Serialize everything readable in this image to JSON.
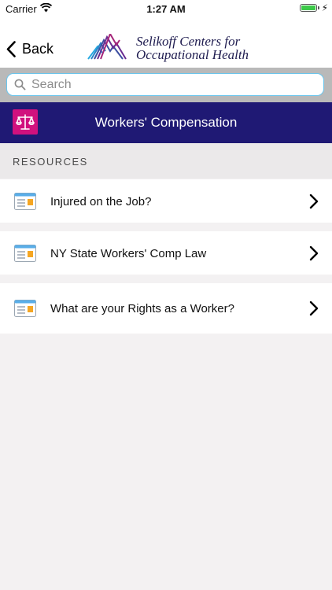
{
  "status": {
    "carrier": "Carrier",
    "time": "1:27 AM",
    "battery_level": 1.0
  },
  "nav": {
    "back_label": "Back",
    "logo_line1": "Selikoff Centers for",
    "logo_line2": "Occupational Health"
  },
  "search": {
    "placeholder": "Search",
    "value": ""
  },
  "category": {
    "title": "Workers' Compensation"
  },
  "section": {
    "label": "RESOURCES"
  },
  "items": [
    {
      "label": "Injured on the Job?"
    },
    {
      "label": "NY State Workers' Comp Law"
    },
    {
      "label": "What are your Rights as a Worker?"
    }
  ],
  "colors": {
    "category_bg": "#1f1974",
    "category_icon_bg": "#d1117e",
    "search_border": "#6ac6ee",
    "battery": "#3dc94a"
  }
}
